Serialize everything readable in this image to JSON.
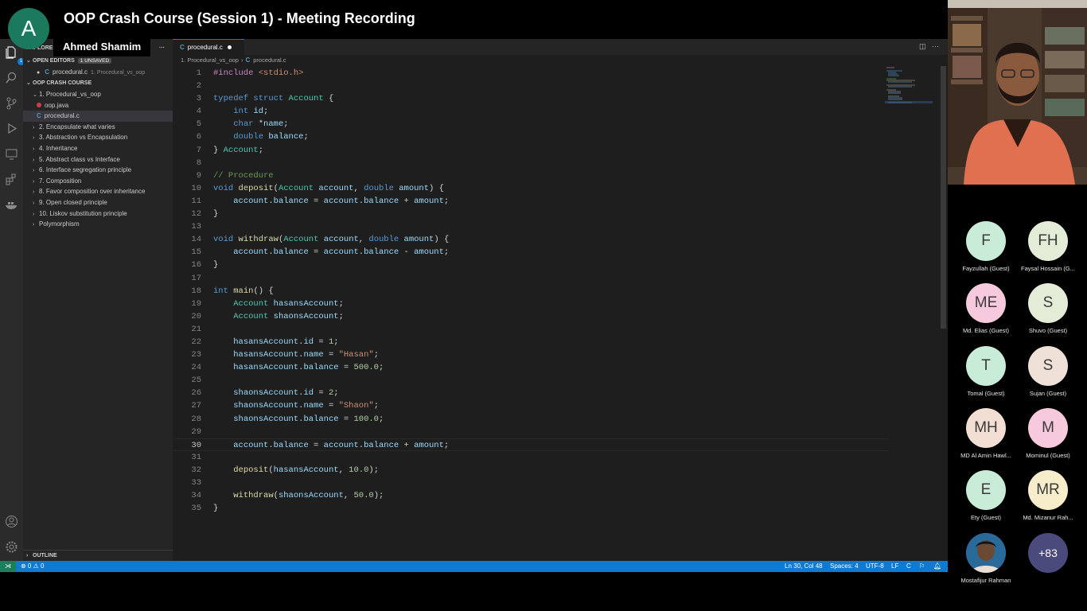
{
  "meeting": {
    "title": "OOP Crash Course (Session 1) - Meeting Recording",
    "host_initial": "A",
    "presenter": "Ahmed Shamim"
  },
  "explorer": {
    "header": "EXPLORER",
    "more": "···",
    "open_editors_label": "OPEN EDITORS",
    "unsaved_badge": "1 UNSAVED",
    "open_file": "procedural.c",
    "open_file_path": "1. Procedural_vs_oop",
    "project_label": "OOP CRASH COURSE",
    "tree": [
      {
        "label": "1. Procedural_vs_oop",
        "kind": "folder-open",
        "indent": 1
      },
      {
        "label": "oop.java",
        "kind": "java",
        "indent": 2
      },
      {
        "label": "procedural.c",
        "kind": "c",
        "indent": 2,
        "selected": true
      },
      {
        "label": "2. Encapsulate what varies",
        "kind": "folder",
        "indent": 1
      },
      {
        "label": "3. Abstraction vs Encapsulation",
        "kind": "folder",
        "indent": 1
      },
      {
        "label": "4. Inheritance",
        "kind": "folder",
        "indent": 1
      },
      {
        "label": "5. Abstract class vs Interface",
        "kind": "folder",
        "indent": 1
      },
      {
        "label": "6. Interface segregation principle",
        "kind": "folder",
        "indent": 1
      },
      {
        "label": "7. Composition",
        "kind": "folder",
        "indent": 1
      },
      {
        "label": "8. Favor composition over inheritance",
        "kind": "folder",
        "indent": 1
      },
      {
        "label": "9. Open closed principle",
        "kind": "folder",
        "indent": 1
      },
      {
        "label": "10. Liskov substitution principle",
        "kind": "folder",
        "indent": 1
      },
      {
        "label": "Polymorphism",
        "kind": "folder",
        "indent": 1
      }
    ],
    "outline_label": "OUTLINE"
  },
  "editor": {
    "tab_label": "procedural.c",
    "breadcrumb_folder": "1. Procedural_vs_oop",
    "breadcrumb_file": "procedural.c",
    "current_line": 30,
    "lines": [
      [
        [
          "pp",
          "#include "
        ],
        [
          "inc",
          "<stdio.h>"
        ]
      ],
      [],
      [
        [
          "kw",
          "typedef"
        ],
        [
          "pl",
          " "
        ],
        [
          "kw",
          "struct"
        ],
        [
          "pl",
          " "
        ],
        [
          "ty",
          "Account"
        ],
        [
          "pl",
          " {"
        ]
      ],
      [
        [
          "pl",
          "    "
        ],
        [
          "kw",
          "int"
        ],
        [
          "pl",
          " "
        ],
        [
          "va",
          "id"
        ],
        [
          "pl",
          ";"
        ]
      ],
      [
        [
          "pl",
          "    "
        ],
        [
          "kw",
          "char"
        ],
        [
          "pl",
          " *"
        ],
        [
          "va",
          "name"
        ],
        [
          "pl",
          ";"
        ]
      ],
      [
        [
          "pl",
          "    "
        ],
        [
          "kw",
          "double"
        ],
        [
          "pl",
          " "
        ],
        [
          "va",
          "balance"
        ],
        [
          "pl",
          ";"
        ]
      ],
      [
        [
          "pl",
          "} "
        ],
        [
          "ty",
          "Account"
        ],
        [
          "pl",
          ";"
        ]
      ],
      [],
      [
        [
          "cm",
          "// Procedure"
        ]
      ],
      [
        [
          "kw",
          "void"
        ],
        [
          "pl",
          " "
        ],
        [
          "fn",
          "deposit"
        ],
        [
          "pl",
          "("
        ],
        [
          "ty",
          "Account"
        ],
        [
          "pl",
          " "
        ],
        [
          "va",
          "account"
        ],
        [
          "pl",
          ", "
        ],
        [
          "kw",
          "double"
        ],
        [
          "pl",
          " "
        ],
        [
          "va",
          "amount"
        ],
        [
          "pl",
          ") {"
        ]
      ],
      [
        [
          "pl",
          "    "
        ],
        [
          "va",
          "account"
        ],
        [
          "pl",
          "."
        ],
        [
          "va",
          "balance"
        ],
        [
          "pl",
          " = "
        ],
        [
          "va",
          "account"
        ],
        [
          "pl",
          "."
        ],
        [
          "va",
          "balance"
        ],
        [
          "pl",
          " + "
        ],
        [
          "va",
          "amount"
        ],
        [
          "pl",
          ";"
        ]
      ],
      [
        [
          "pl",
          "}"
        ]
      ],
      [],
      [
        [
          "kw",
          "void"
        ],
        [
          "pl",
          " "
        ],
        [
          "fn",
          "withdraw"
        ],
        [
          "pl",
          "("
        ],
        [
          "ty",
          "Account"
        ],
        [
          "pl",
          " "
        ],
        [
          "va",
          "account"
        ],
        [
          "pl",
          ", "
        ],
        [
          "kw",
          "double"
        ],
        [
          "pl",
          " "
        ],
        [
          "va",
          "amount"
        ],
        [
          "pl",
          ") {"
        ]
      ],
      [
        [
          "pl",
          "    "
        ],
        [
          "va",
          "account"
        ],
        [
          "pl",
          "."
        ],
        [
          "va",
          "balance"
        ],
        [
          "pl",
          " = "
        ],
        [
          "va",
          "account"
        ],
        [
          "pl",
          "."
        ],
        [
          "va",
          "balance"
        ],
        [
          "pl",
          " - "
        ],
        [
          "va",
          "amount"
        ],
        [
          "pl",
          ";"
        ]
      ],
      [
        [
          "pl",
          "}"
        ]
      ],
      [],
      [
        [
          "kw",
          "int"
        ],
        [
          "pl",
          " "
        ],
        [
          "fn",
          "main"
        ],
        [
          "pl",
          "() {"
        ]
      ],
      [
        [
          "pl",
          "    "
        ],
        [
          "ty",
          "Account"
        ],
        [
          "pl",
          " "
        ],
        [
          "va",
          "hasansAccount"
        ],
        [
          "pl",
          ";"
        ]
      ],
      [
        [
          "pl",
          "    "
        ],
        [
          "ty",
          "Account"
        ],
        [
          "pl",
          " "
        ],
        [
          "va",
          "shaonsAccount"
        ],
        [
          "pl",
          ";"
        ]
      ],
      [],
      [
        [
          "pl",
          "    "
        ],
        [
          "va",
          "hasansAccount"
        ],
        [
          "pl",
          "."
        ],
        [
          "va",
          "id"
        ],
        [
          "pl",
          " = "
        ],
        [
          "num",
          "1"
        ],
        [
          "pl",
          ";"
        ]
      ],
      [
        [
          "pl",
          "    "
        ],
        [
          "va",
          "hasansAccount"
        ],
        [
          "pl",
          "."
        ],
        [
          "va",
          "name"
        ],
        [
          "pl",
          " = "
        ],
        [
          "str",
          "\"Hasan\""
        ],
        [
          "pl",
          ";"
        ]
      ],
      [
        [
          "pl",
          "    "
        ],
        [
          "va",
          "hasansAccount"
        ],
        [
          "pl",
          "."
        ],
        [
          "va",
          "balance"
        ],
        [
          "pl",
          " = "
        ],
        [
          "num",
          "500.0"
        ],
        [
          "pl",
          ";"
        ]
      ],
      [],
      [
        [
          "pl",
          "    "
        ],
        [
          "va",
          "shaonsAccount"
        ],
        [
          "pl",
          "."
        ],
        [
          "va",
          "id"
        ],
        [
          "pl",
          " = "
        ],
        [
          "num",
          "2"
        ],
        [
          "pl",
          ";"
        ]
      ],
      [
        [
          "pl",
          "    "
        ],
        [
          "va",
          "shaonsAccount"
        ],
        [
          "pl",
          "."
        ],
        [
          "va",
          "name"
        ],
        [
          "pl",
          " = "
        ],
        [
          "str",
          "\"Shaon\""
        ],
        [
          "pl",
          ";"
        ]
      ],
      [
        [
          "pl",
          "    "
        ],
        [
          "va",
          "shaonsAccount"
        ],
        [
          "pl",
          "."
        ],
        [
          "va",
          "balance"
        ],
        [
          "pl",
          " = "
        ],
        [
          "num",
          "100.0"
        ],
        [
          "pl",
          ";"
        ]
      ],
      [],
      [
        [
          "pl",
          "    "
        ],
        [
          "va",
          "account"
        ],
        [
          "pl",
          "."
        ],
        [
          "va",
          "balance"
        ],
        [
          "pl",
          " = "
        ],
        [
          "va",
          "account"
        ],
        [
          "pl",
          "."
        ],
        [
          "va",
          "balance"
        ],
        [
          "pl",
          " + "
        ],
        [
          "va",
          "amount"
        ],
        [
          "pl",
          ";"
        ]
      ],
      [],
      [
        [
          "pl",
          "    "
        ],
        [
          "fn",
          "deposit"
        ],
        [
          "pl",
          "("
        ],
        [
          "va",
          "hasansAccount"
        ],
        [
          "pl",
          ", "
        ],
        [
          "num",
          "10.0"
        ],
        [
          "pl",
          ");"
        ]
      ],
      [],
      [
        [
          "pl",
          "    "
        ],
        [
          "fn",
          "withdraw"
        ],
        [
          "pl",
          "("
        ],
        [
          "va",
          "shaonsAccount"
        ],
        [
          "pl",
          ", "
        ],
        [
          "num",
          "50.0"
        ],
        [
          "pl",
          ");"
        ]
      ],
      [
        [
          "pl",
          "}"
        ]
      ]
    ]
  },
  "status_bar": {
    "problems": "⊗ 0 ⚠ 0",
    "position": "Ln 30, Col 48",
    "spaces": "Spaces: 4",
    "encoding": "UTF-8",
    "eol": "LF",
    "language": "C"
  },
  "participants": [
    {
      "initials": "F",
      "name": "Fayzullah (Guest)",
      "color": "#c8ecd8"
    },
    {
      "initials": "FH",
      "name": "Faysal Hossain (G...",
      "color": "#e3ecd6"
    },
    {
      "initials": "ME",
      "name": "Md. Elias (Guest)",
      "color": "#f6c9dc"
    },
    {
      "initials": "S",
      "name": "Shuvo (Guest)",
      "color": "#e3ecd6"
    },
    {
      "initials": "T",
      "name": "Tomal (Guest)",
      "color": "#c8ecd8"
    },
    {
      "initials": "S",
      "name": "Sujan (Guest)",
      "color": "#efe1d8"
    },
    {
      "initials": "MH",
      "name": "MD Al Amin Hawl...",
      "color": "#f3ded3"
    },
    {
      "initials": "M",
      "name": "Mominul (Guest)",
      "color": "#f6c9dc"
    },
    {
      "initials": "E",
      "name": "Ety (Guest)",
      "color": "#c8ecd8"
    },
    {
      "initials": "MR",
      "name": "Md. Mizanur Rah...",
      "color": "#f8edcb"
    },
    {
      "initials": "",
      "name": "Mostafijur Rahman",
      "color": "#2a5a8a",
      "photo": true
    },
    {
      "initials": "+83",
      "name": "",
      "color": "#4b4a7d",
      "more": true
    }
  ]
}
